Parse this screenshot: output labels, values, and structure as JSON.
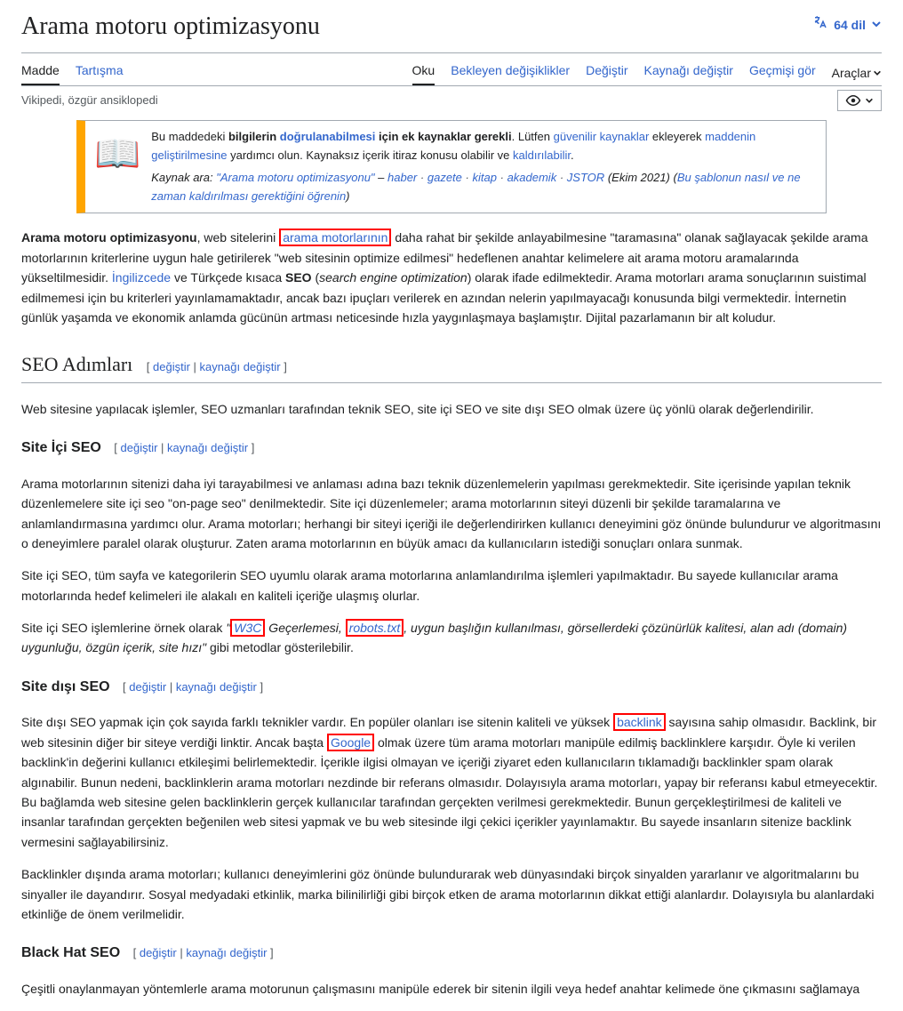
{
  "header": {
    "title": "Arama motoru optimizasyonu",
    "languages": "64 dil"
  },
  "tabs": {
    "left": {
      "madde": "Madde",
      "tartisma": "Tartışma"
    },
    "right": {
      "oku": "Oku",
      "bekleyen": "Bekleyen değişiklikler",
      "degistir": "Değiştir",
      "kaynagi": "Kaynağı değiştir",
      "gecmis": "Geçmişi gör",
      "araclar": "Araçlar"
    }
  },
  "subtitle": "Vikipedi, özgür ansiklopedi",
  "notice": {
    "line1_pre": "Bu maddedeki ",
    "line1_bold1": "bilgilerin ",
    "line1_link1": "doğrulanabilmesi",
    "line1_bold2": " için ek kaynaklar gerekli",
    "line1_post": ". Lütfen ",
    "line1_link2": "güvenilir kaynaklar",
    "line1_end": " ekleyerek ",
    "line2_link": "maddenin geliştirilmesine",
    "line2_post": " yardımcı olun. Kaynaksız içerik itiraz konusu olabilir ve ",
    "line2_link2": "kaldırılabilir",
    "line2_dot": ".",
    "line3_pre": "Kaynak ara: ",
    "line3_q": "\"Arama motoru optimizasyonu\"",
    "line3_dash": " – ",
    "line3_haber": "haber",
    "line3_gazete": "gazete",
    "line3_kitap": "kitap",
    "line3_akademik": "akademik",
    "line3_jstor": "JSTOR",
    "line3_date": "(Ekim 2021)",
    "line3_paren_open": " (",
    "line3_template": "Bu şablonun nasıl ve ne zaman kaldırılması gerektiğini öğrenin",
    "line3_paren_close": ")"
  },
  "intro": {
    "bold1": "Arama motoru optimizasyonu",
    "t1": ", web sitelerini ",
    "link_arama": "arama motorlarının",
    "t2": " daha rahat bir şekilde anlayabilmesine \"taramasına\" olanak sağlayacak şekilde arama motorlarının kriterlerine uygun hale getirilerek \"web sitesinin optimize edilmesi\" hedeflenen anahtar kelimelere ait arama motoru aramalarında yükseltilmesidir. ",
    "link_ing": "İngilizcede",
    "t3": " ve Türkçede kısaca ",
    "bold_seo": "SEO",
    "t4": " (",
    "italic_seo": "search engine optimization",
    "t5": ") olarak ifade edilmektedir. Arama motorları arama sonuçlarının suistimal edilmemesi için bu kriterleri yayınlamamaktadır, ancak bazı ipuçları verilerek en azından nelerin yapılmayacağı konusunda bilgi vermektedir. İnternetin günlük yaşamda ve ekonomik anlamda gücünün artması neticesinde hızla yaygınlaşmaya başlamıştır. Dijital pazarlamanın bir alt koludur."
  },
  "edit": {
    "bracket_open": "[ ",
    "degistir": "değiştir",
    "sep": " | ",
    "kaynagi": "kaynağı değiştir",
    "bracket_close": " ]"
  },
  "h2_seo": "SEO Adımları",
  "p_seo_steps": "Web sitesine yapılacak işlemler, SEO uzmanları tarafından teknik SEO, site içi SEO ve site dışı SEO olmak üzere üç yönlü olarak değerlendirilir.",
  "h3_site_ici": "Site İçi SEO",
  "p_ici1": "Arama motorlarının sitenizi daha iyi tarayabilmesi ve anlaması adına bazı teknik düzenlemelerin yapılması gerekmektedir. Site içerisinde yapılan teknik düzenlemelere site içi seo \"on-page seo\" denilmektedir. Site içi düzenlemeler; arama motorlarının siteyi düzenli bir şekilde taramalarına ve anlamlandırmasına yardımcı olur. Arama motorları; herhangi bir siteyi içeriği ile değerlendirirken kullanıcı deneyimini göz önünde bulundurur ve algoritmasını o deneyimlere paralel olarak oluşturur. Zaten arama motorlarının en büyük amacı da kullanıcıların istediği sonuçları onlara sunmak.",
  "p_ici2": "Site içi SEO, tüm sayfa ve kategorilerin SEO uyumlu olarak arama motorlarına anlamlandırılma işlemleri yapılmaktadır. Bu sayede kullanıcılar arama motorlarında hedef kelimeleri ile alakalı en kaliteli içeriğe ulaşmış olurlar.",
  "p_ici3": {
    "t1": "Site içi SEO işlemlerine örnek olarak ",
    "q1": "\"",
    "link_w3c": "W3C",
    "t2": " Geçerlemesi, ",
    "link_robots": "robots.txt",
    "t3": ", uygun başlığın kullanılması, görsellerdeki çözünürlük kalitesi, alan adı (domain) uygunluğu, özgün içerik, site hızı\"",
    "t4": " gibi metodlar gösterilebilir."
  },
  "h3_site_disi": "Site dışı SEO",
  "p_disi1": {
    "t1": "Site dışı SEO yapmak için çok sayıda farklı teknikler vardır. En popüler olanları ise sitenin kaliteli ve yüksek ",
    "link_backlink": "backlink",
    "t2": " sayısına sahip olmasıdır. Backlink, bir web sitesinin diğer bir siteye verdiği linktir. Ancak başta ",
    "link_google": "Google",
    "t3": " olmak üzere tüm arama motorları manipüle edilmiş backlinklere karşıdır. Öyle ki verilen backlink'in değerini kullanıcı etkileşimi belirlemektedir. İçerikle ilgisi olmayan ve içeriği ziyaret eden kullanıcıların tıklamadığı backlinkler spam olarak algınabilir. Bunun nedeni, backlinklerin arama motorları nezdinde bir referans olmasıdır. Dolayısıyla arama motorları, yapay bir referansı kabul etmeyecektir. Bu bağlamda web sitesine gelen backlinklerin gerçek kullanıcılar tarafından gerçekten verilmesi gerekmektedir. Bunun gerçekleştirilmesi de kaliteli ve insanlar tarafından gerçekten beğenilen web sitesi yapmak ve bu web sitesinde ilgi çekici içerikler yayınlamaktır. Bu sayede insanların sitenize backlink vermesini sağlayabilirsiniz."
  },
  "p_disi2": "Backlinkler dışında arama motorları; kullanıcı deneyimlerini göz önünde bulundurarak web dünyasındaki birçok sinyalden yararlanır ve algoritmalarını bu sinyaller ile dayandırır. Sosyal medyadaki etkinlik, marka bilinilirliği gibi birçok etken de arama motorlarının dikkat ettiği alanlardır. Dolayısıyla bu alanlardaki etkinliğe de önem verilmelidir.",
  "h3_blackhat": "Black Hat SEO",
  "p_blackhat": "Çeşitli onaylanmayan yöntemlerle arama motorunun çalışmasını manipüle ederek bir sitenin ilgili veya hedef anahtar kelimede öne çıkmasını sağlamaya"
}
